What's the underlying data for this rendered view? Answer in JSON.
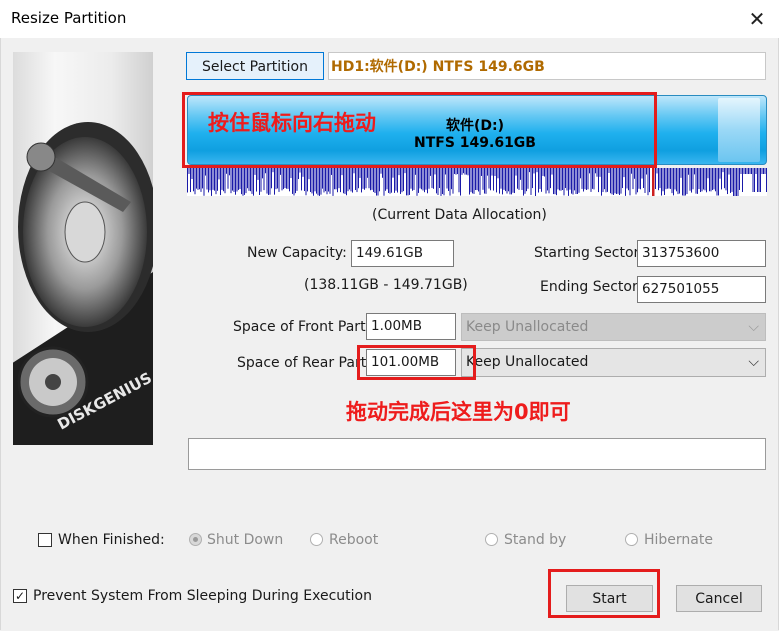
{
  "window": {
    "title": "Resize Partition",
    "close_glyph": "✕"
  },
  "brand": {
    "logo_text": "DISKGENIUS"
  },
  "partition": {
    "select_button": "Select Partition",
    "info": "HD1:软件(D:) NTFS 149.6GB",
    "bar_name": "软件(D:)",
    "bar_size": "NTFS 149.61GB",
    "drag_hint": "按住鼠标向右拖动",
    "allocation_caption": "(Current Data Allocation)"
  },
  "fields": {
    "new_capacity_label": "New Capacity:",
    "new_capacity_value": "149.61GB",
    "capacity_range": "(138.11GB - 149.71GB)",
    "starting_sector_label": "Starting Sector:",
    "starting_sector_value": "313753600",
    "ending_sector_label": "Ending Sector:",
    "ending_sector_value": "627501055",
    "front_space_label": "Space of Front Part:",
    "front_space_value": "1.00MB",
    "front_mode": "Keep Unallocated",
    "rear_space_label": "Space of Rear Part",
    "rear_space_value": "101.00MB",
    "rear_mode": "Keep Unallocated"
  },
  "annotation": {
    "rear_hint": "拖动完成后这里为0即可"
  },
  "when_finished": {
    "label": "When Finished:",
    "checked": false,
    "options": [
      "Shut Down",
      "Reboot",
      "Stand by",
      "Hibernate"
    ]
  },
  "prevent_sleep": {
    "label": "Prevent System From Sleeping During Execution",
    "checked": true
  },
  "actions": {
    "start": "Start",
    "cancel": "Cancel"
  },
  "colors": {
    "accent_red": "#e41c1c",
    "bar_blue": "#1fb0ee",
    "info_brown": "#b06a00"
  }
}
